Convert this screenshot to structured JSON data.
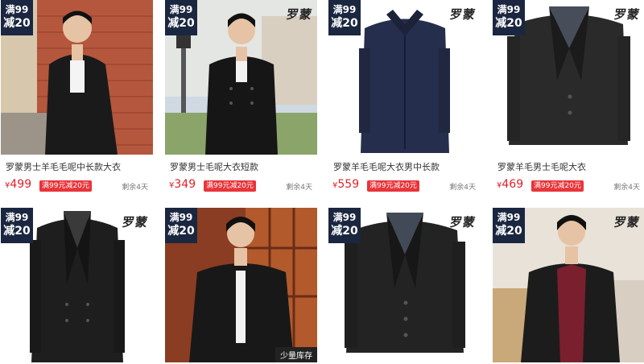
{
  "badge": {
    "line1": "满99",
    "line2": "减20"
  },
  "brand": "罗蒙",
  "products": [
    {
      "title": "罗蒙男士羊毛毛呢中长款大衣",
      "currency": "¥",
      "price": "499",
      "promo": "满99元减20元",
      "remaining": "剩余4天",
      "image": "man-in-black-wool-coat-brick-wall-photo"
    },
    {
      "title": "罗蒙男士毛呢大衣短款",
      "currency": "¥",
      "price": "349",
      "promo": "满99元减20元",
      "remaining": "剩余4天",
      "image": "man-in-double-breasted-short-coat-photo"
    },
    {
      "title": "罗蒙羊毛毛呢大衣男中长款",
      "currency": "¥",
      "price": "559",
      "promo": "满99元减20元",
      "remaining": "剩余4天",
      "image": "navy-wool-overcoat-product-photo"
    },
    {
      "title": "罗蒙羊毛男士毛呢大衣",
      "currency": "¥",
      "price": "469",
      "promo": "满99元减20元",
      "remaining": "剩余4天",
      "image": "black-wool-blazer-coat-product-photo"
    },
    {
      "title": "",
      "image": "black-double-breasted-coat-product-photo"
    },
    {
      "title": "",
      "image": "man-in-black-cotton-jacket-photo",
      "stock_label": "少量库存"
    },
    {
      "title": "",
      "image": "black-notch-lapel-coat-product-photo"
    },
    {
      "title": "",
      "image": "man-in-long-black-coat-red-sweater-photo"
    }
  ]
}
